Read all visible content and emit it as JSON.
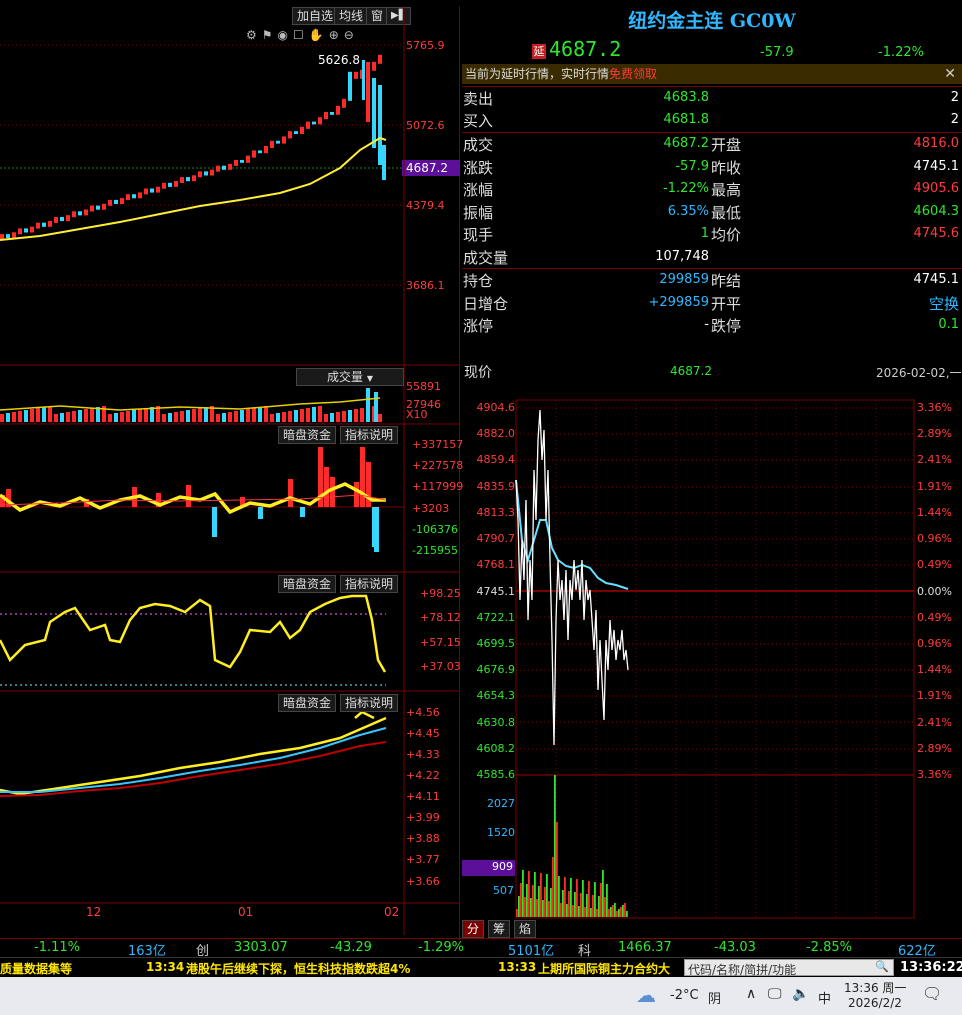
{
  "toolbar": {
    "add_watch": "加自选",
    "ma": "均线",
    "window": "窗",
    "collapse": "▶▌"
  },
  "kline": {
    "y_labels": [
      "5765.9",
      "5072.6",
      "4379.4",
      "3686.1"
    ],
    "high_marker": "5626.8",
    "current_price_tag": "4687.2",
    "x_labels": [
      "12",
      "01",
      "02"
    ]
  },
  "volume": {
    "dropdown": "成交量",
    "labels": [
      "55891",
      "27946",
      "X10"
    ]
  },
  "ind1": {
    "btn1": "暗盘资金",
    "btn2": "指标说明",
    "labels": [
      "+337157",
      "+227578",
      "+117999",
      "+3203",
      "-106376",
      "-215955"
    ]
  },
  "ind2": {
    "btn1": "暗盘资金",
    "btn2": "指标说明",
    "labels": [
      "+98.25",
      "+78.12",
      "+57.15",
      "+37.03"
    ]
  },
  "ind3": {
    "btn1": "暗盘资金",
    "btn2": "指标说明",
    "labels": [
      "+4.56",
      "+4.45",
      "+4.33",
      "+4.22",
      "+4.11",
      "+3.99",
      "+3.88",
      "+3.77",
      "+3.66"
    ]
  },
  "header": {
    "title": "纽约金主连 GC0W",
    "delay_badge": "延",
    "price": "4687.2",
    "change": "-57.9",
    "pct": "-1.22%"
  },
  "notice": {
    "text": "当前为延时行情，实时行情",
    "link": "免费领取"
  },
  "quote": {
    "ask_label": "卖出",
    "ask_price": "4683.8",
    "ask_vol": "2",
    "bid_label": "买入",
    "bid_price": "4681.8",
    "bid_vol": "2",
    "rows": [
      {
        "k": "成交",
        "v": "4687.2",
        "k2": "开盘",
        "v2": "4816.0"
      },
      {
        "k": "涨跌",
        "v": "-57.9",
        "k2": "昨收",
        "v2": "4745.1"
      },
      {
        "k": "涨幅",
        "v": "-1.22%",
        "k2": "最高",
        "v2": "4905.6"
      },
      {
        "k": "振幅",
        "v": "6.35%",
        "k2": "最低",
        "v2": "4604.3"
      },
      {
        "k": "现手",
        "v": "1",
        "k2": "均价",
        "v2": "4745.6"
      }
    ],
    "volume_label": "成交量",
    "volume_value": "107,748",
    "rows2": [
      {
        "k": "持仓",
        "v": "299859",
        "k2": "昨结",
        "v2": "4745.1"
      },
      {
        "k": "日增仓",
        "v": "+299859",
        "k2": "开平",
        "v2": "空换"
      },
      {
        "k": "涨停",
        "v": "-",
        "k2": "跌停",
        "v2": "0.1"
      }
    ]
  },
  "intraday": {
    "now_label": "现价",
    "now_value": "4687.2",
    "date": "2026-02-02,一",
    "left_labels": [
      "4904.6",
      "4882.0",
      "4859.4",
      "4835.9",
      "4813.3",
      "4790.7",
      "4768.1",
      "4745.1",
      "4722.1",
      "4699.5",
      "4676.9",
      "4654.3",
      "4630.8",
      "4608.2",
      "4585.6"
    ],
    "right_labels": [
      "3.36%",
      "2.89%",
      "2.41%",
      "1.91%",
      "1.44%",
      "0.96%",
      "0.49%",
      "0.00%",
      "0.49%",
      "0.96%",
      "1.44%",
      "1.91%",
      "2.41%",
      "2.89%",
      "3.36%"
    ],
    "vol_labels": [
      "2027",
      "1520",
      "909",
      "507"
    ],
    "tabs": [
      "分",
      "筹",
      "焰"
    ]
  },
  "statusbar": {
    "pct1": "-1.11%",
    "amt1": "163亿",
    "name2": "创",
    "idx2": "3303.07",
    "chg2": "-43.29",
    "pct2": "-1.29%",
    "amt2": "5101亿",
    "name3": "科",
    "idx3": "1466.37",
    "chg3": "-43.03",
    "pct3": "-2.85%",
    "amt3": "622亿"
  },
  "ticker": {
    "n1": "质量数据集等",
    "t2": "13:34",
    "n2": "港股午后继续下探，恒生科技指数跌超4%",
    "t3": "13:33",
    "n3": "上期所国际铜主力合约大",
    "search_placeholder": "代码/名称/简拼/功能",
    "clock": "13:36:22"
  },
  "taskbar": {
    "temp": "-2°C",
    "weather": "阴",
    "ime": "中",
    "time": "13:36 周一",
    "date": "2026/2/2"
  }
}
